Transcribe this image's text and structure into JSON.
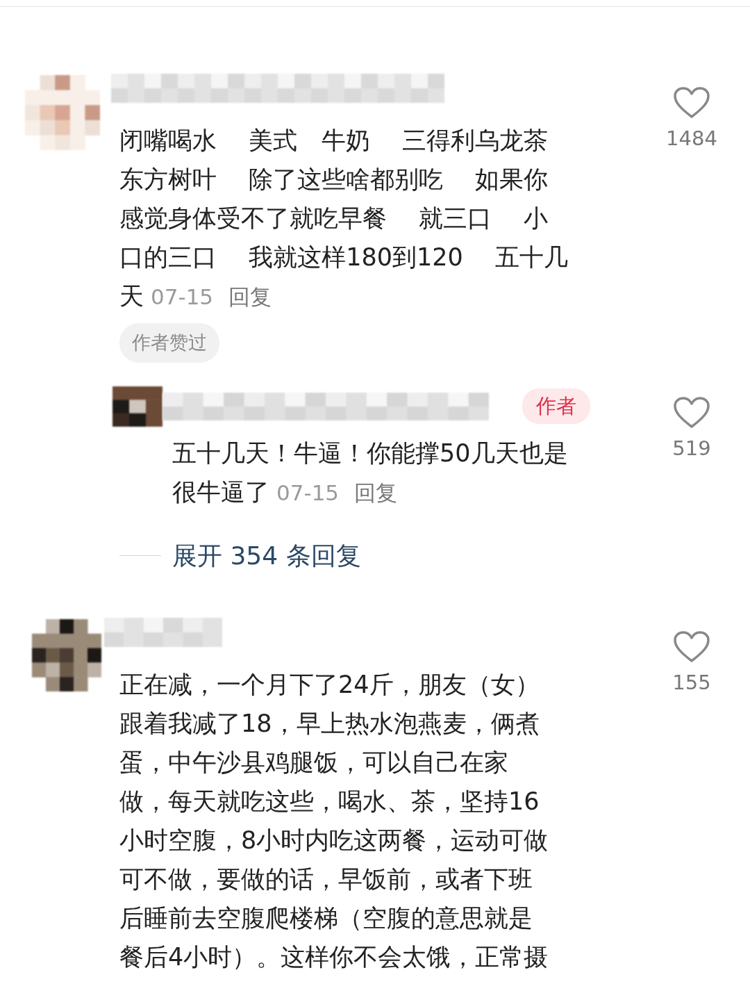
{
  "comments": [
    {
      "kind": "comment",
      "lines": [
        "闭嘴喝水　 美式　牛奶　 三得利乌龙茶",
        "东方树叶　 除了这些啥都别吃　 如果你",
        "感觉身体受不了就吃早餐　 就三口　 小",
        "口的三口　 我就这样180到120　 五十几",
        "天"
      ],
      "date": "07-15",
      "reply": "回复",
      "tag": "作者赞过",
      "likes": "1484"
    },
    {
      "kind": "reply",
      "author_badge": "作者",
      "lines": [
        "五十几天！牛逼！你能撑50几天也是",
        "很牛逼了"
      ],
      "date": "07-15",
      "reply": "回复",
      "likes": "519"
    },
    {
      "kind": "expand",
      "text": "展开 354 条回复"
    },
    {
      "kind": "comment",
      "lines": [
        "正在减，一个月下了24斤，朋友（女）",
        "跟着我减了18，早上热水泡燕麦，俩煮",
        "蛋，中午沙县鸡腿饭，可以自己在家",
        "做，每天就吃这些，喝水、茶，坚持16",
        "小时空腹，8小时内吃这两餐，运动可做",
        "可不做，要做的话，早饭前，或者下班",
        "后睡前去空腹爬楼梯（空腹的意思就是",
        "餐后4小时）。这样你不会太饿，正常摄"
      ],
      "likes": "155"
    }
  ]
}
